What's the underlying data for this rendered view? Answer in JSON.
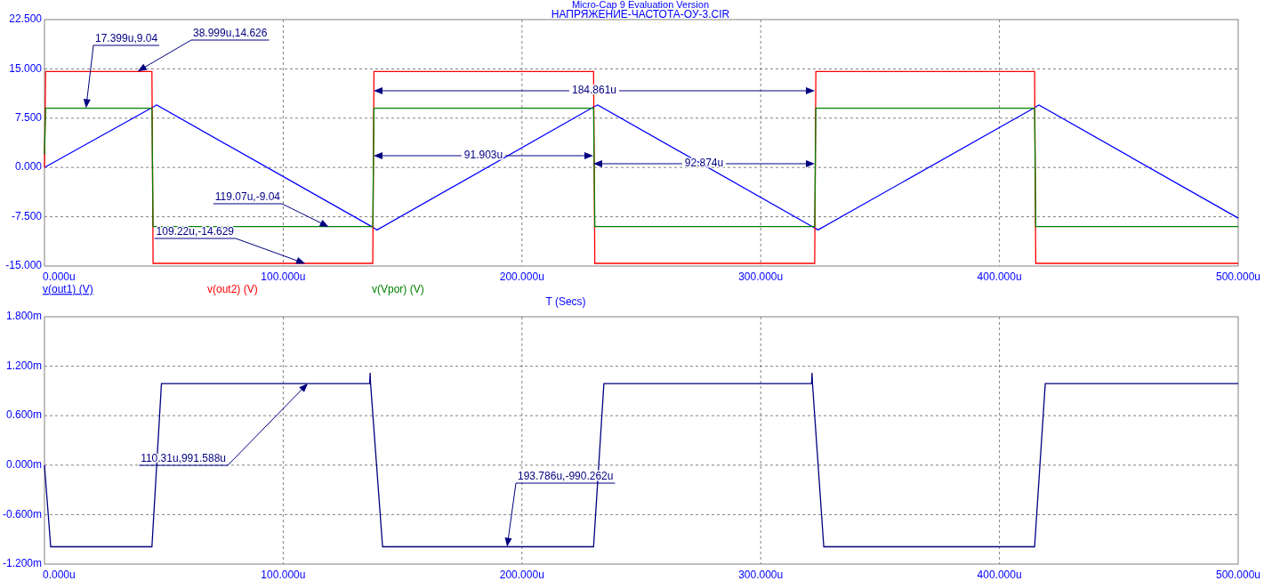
{
  "header": {
    "product": "Micro-Cap 9 Evaluation Version",
    "file": "НАПРЯЖЕНИЕ-ЧАСТОТА-ОУ-3.CIR"
  },
  "plots": [
    {
      "legend": [
        {
          "selected": true
        },
        {
          "selected": false
        },
        {
          "selected": false
        }
      ],
      "chart_data": {
        "type": "line",
        "xlabel": "T (Secs)",
        "grid": true,
        "x": [
          0,
          0.5,
          45,
          45.5,
          47,
          137.5,
          138,
          139.3,
          230,
          230.5,
          231.7,
          322.6,
          323.1,
          324,
          414.7,
          415.2,
          416.5,
          500
        ],
        "series": [
          {
            "name": "v(out1) (V)",
            "color": "#0000ff",
            "values": [
              0,
              0.1,
              9.1,
              9.2,
              9.5,
              -9.1,
              -9.2,
              -9.5,
              9.2,
              9.3,
              9.5,
              -9.2,
              -9.3,
              -9.5,
              9.1,
              9.2,
              9.5,
              -7.7
            ]
          },
          {
            "name": "v(out2) (V)",
            "color": "#ff0000",
            "values": [
              0,
              14.6,
              14.6,
              -14.6,
              -14.6,
              -14.6,
              14.6,
              14.6,
              14.6,
              -14.6,
              -14.6,
              -14.6,
              14.6,
              14.6,
              14.6,
              -14.6,
              -14.6,
              -14.6
            ]
          },
          {
            "name": "v(Vpor) (V)",
            "color": "#008000",
            "values": [
              2,
              9,
              9,
              -9,
              -9,
              -9,
              9,
              9,
              9,
              -9,
              -9,
              -9,
              9,
              9,
              9,
              -9,
              -9,
              -9
            ]
          }
        ],
        "xlim": [
          0,
          500
        ],
        "ylim": [
          -15,
          22.5
        ],
        "xticks": [
          {
            "value": 0,
            "label": "0.000u"
          },
          {
            "value": 100,
            "label": "100.000u"
          },
          {
            "value": 200,
            "label": "200.000u"
          },
          {
            "value": 300,
            "label": "300.000u"
          },
          {
            "value": 400,
            "label": "400.000u"
          },
          {
            "value": 500,
            "label": "500.000u"
          }
        ],
        "yticks": [
          {
            "value": -15,
            "label": "-15.000"
          },
          {
            "value": -7.5,
            "label": "-7.500"
          },
          {
            "value": 0,
            "label": "0.000"
          },
          {
            "value": 7.5,
            "label": "7.500"
          },
          {
            "value": 15,
            "label": "15.000"
          },
          {
            "value": 22.5,
            "label": "22.500"
          }
        ],
        "annotations": [
          {
            "text": "17.399u,9.04",
            "x": 17.399,
            "y": 9.04
          },
          {
            "text": "38.999u,14.626",
            "x": 38.999,
            "y": 14.626
          },
          "184.861u",
          "91.903u",
          "92.874u",
          {
            "text": "119.07u,-9.04",
            "x": 119.07,
            "y": -9.04
          },
          {
            "text": "109.22u,-14.629",
            "x": 109.22,
            "y": -14.629
          }
        ]
      }
    },
    {
      "chart_data": {
        "type": "line",
        "grid": true,
        "x": [
          0,
          2.6,
          45,
          49,
          136.2,
          136.4,
          136.6,
          141.6,
          230,
          234.3,
          321.3,
          321.5,
          321.7,
          326.4,
          414.7,
          419.2,
          500
        ],
        "series": [
          {
            "color": "#000080",
            "values": [
              0,
              -0.99,
              -0.99,
              0.99,
              0.99,
              1.12,
              0.99,
              -0.99,
              -0.99,
              0.99,
              0.99,
              1.12,
              0.99,
              -0.99,
              -0.99,
              0.99,
              0.99
            ]
          }
        ],
        "xlim": [
          0,
          500
        ],
        "ylim": [
          -1.2,
          1.8
        ],
        "xticks": [
          {
            "value": 0,
            "label": "0.000u"
          },
          {
            "value": 100,
            "label": "100.000u"
          },
          {
            "value": 200,
            "label": "200.000u"
          },
          {
            "value": 300,
            "label": "300.000u"
          },
          {
            "value": 400,
            "label": "400.000u"
          },
          {
            "value": 500,
            "label": "500.000u"
          }
        ],
        "yticks": [
          {
            "value": -1.2,
            "label": "-1.200m"
          },
          {
            "value": -0.6,
            "label": "-0.600m"
          },
          {
            "value": 0,
            "label": "0.000m"
          },
          {
            "value": 0.6,
            "label": "0.600m"
          },
          {
            "value": 1.2,
            "label": "1.200m"
          },
          {
            "value": 1.8,
            "label": "1.800m"
          }
        ],
        "annotations": [
          {
            "text": "110.31u,991.588u",
            "x": 110.31,
            "y": 0.991588
          },
          {
            "text": "193.786u,-990.262u",
            "x": 193.786,
            "y": -0.990262
          }
        ]
      }
    }
  ]
}
